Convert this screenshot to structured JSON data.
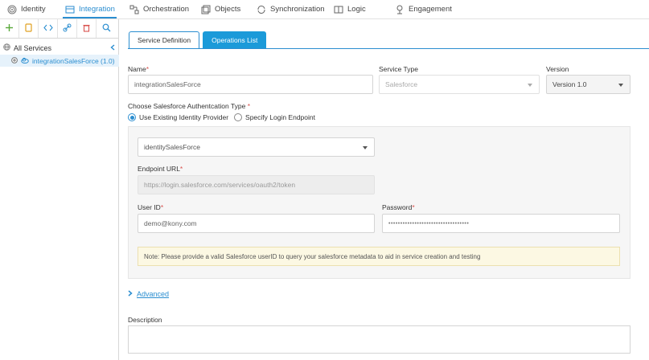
{
  "nav": {
    "items": [
      {
        "label": "Identity",
        "icon": "fingerprint-icon",
        "active": false
      },
      {
        "label": "Integration",
        "icon": "integration-icon",
        "active": true
      },
      {
        "label": "Orchestration",
        "icon": "orchestration-icon",
        "active": false
      },
      {
        "label": "Objects",
        "icon": "objects-icon",
        "active": false
      },
      {
        "label": "Synchronization",
        "icon": "sync-icon",
        "active": false
      },
      {
        "label": "Logic",
        "icon": "logic-icon",
        "active": false
      },
      {
        "label": "Engagement",
        "icon": "engagement-icon",
        "active": false
      }
    ]
  },
  "toolbar": {
    "buttons": [
      "add-icon",
      "document-icon",
      "code-icon",
      "link-icon",
      "trash-icon",
      "search-icon"
    ]
  },
  "tree": {
    "root_label": "All Services",
    "child_label": "integrationSalesForce (1.0)"
  },
  "tabs": {
    "service_definition": "Service Definition",
    "operations_list": "Operations List"
  },
  "form": {
    "name_label": "Name",
    "name_value": "integrationSalesForce",
    "service_type_label": "Service Type",
    "service_type_value": "Salesforce",
    "version_label": "Version",
    "version_value": "Version 1.0",
    "auth_type_label": "Choose Salesforce Authentcation Type",
    "radio_existing": "Use Existing Identity Provider",
    "radio_specify": "Specify Login Endpoint",
    "identity_value": "identitySalesForce",
    "endpoint_label": "Endpoint URL",
    "endpoint_value": "https://login.salesforce.com/services/oauth2/token",
    "userid_label": "User ID",
    "userid_value": "demo@kony.com",
    "password_label": "Password",
    "password_value": "••••••••••••••••••••••••••••••••••",
    "note": "Note: Please provide a valid Salesforce userID to query your salesforce metadata to aid in service creation and testing",
    "advanced": "Advanced",
    "description_label": "Description",
    "required_mark": "*"
  },
  "colors": {
    "accent": "#2b8ed0",
    "tab_active_bg": "#1b9ad9",
    "note_bg": "#fcf8e3",
    "required": "#d9534f"
  }
}
